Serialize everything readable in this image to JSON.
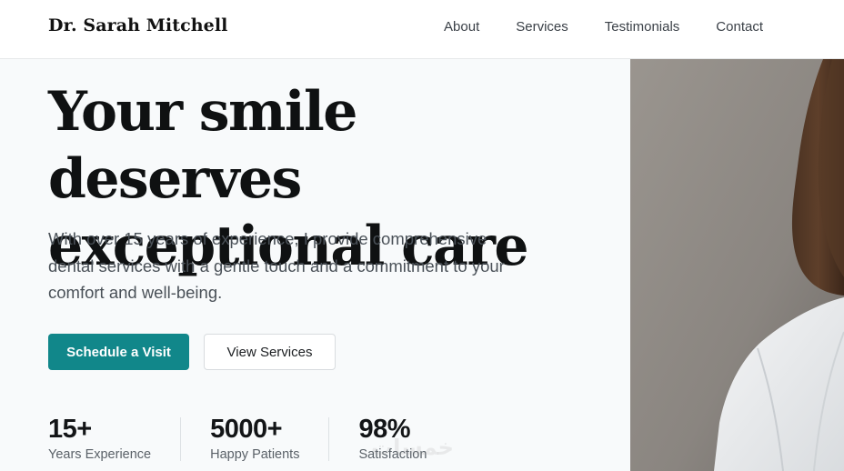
{
  "header": {
    "brand": "Dr. Sarah Mitchell",
    "nav": [
      {
        "label": "About"
      },
      {
        "label": "Services"
      },
      {
        "label": "Testimonials"
      },
      {
        "label": "Contact"
      }
    ]
  },
  "hero": {
    "headline_line1": "Your smile deserves",
    "headline_line2": "exceptional care",
    "lead": "With over 15 years of experience, I provide comprehensive dental services with a gentle touch and a commitment to your comfort and well-being.",
    "primary_cta": "Schedule a Visit",
    "secondary_cta": "View Services"
  },
  "stats": [
    {
      "value": "15+",
      "label": "Years Experience"
    },
    {
      "value": "5000+",
      "label": "Happy Patients"
    },
    {
      "value": "98%",
      "label": "Satisfaction"
    }
  ],
  "watermark": "خمسات",
  "colors": {
    "accent": "#11878a",
    "headline": "#0f1112",
    "body_text": "#4a5158",
    "page_bg": "#f8fafb",
    "photo_bg": "#8b8681"
  },
  "icons": []
}
